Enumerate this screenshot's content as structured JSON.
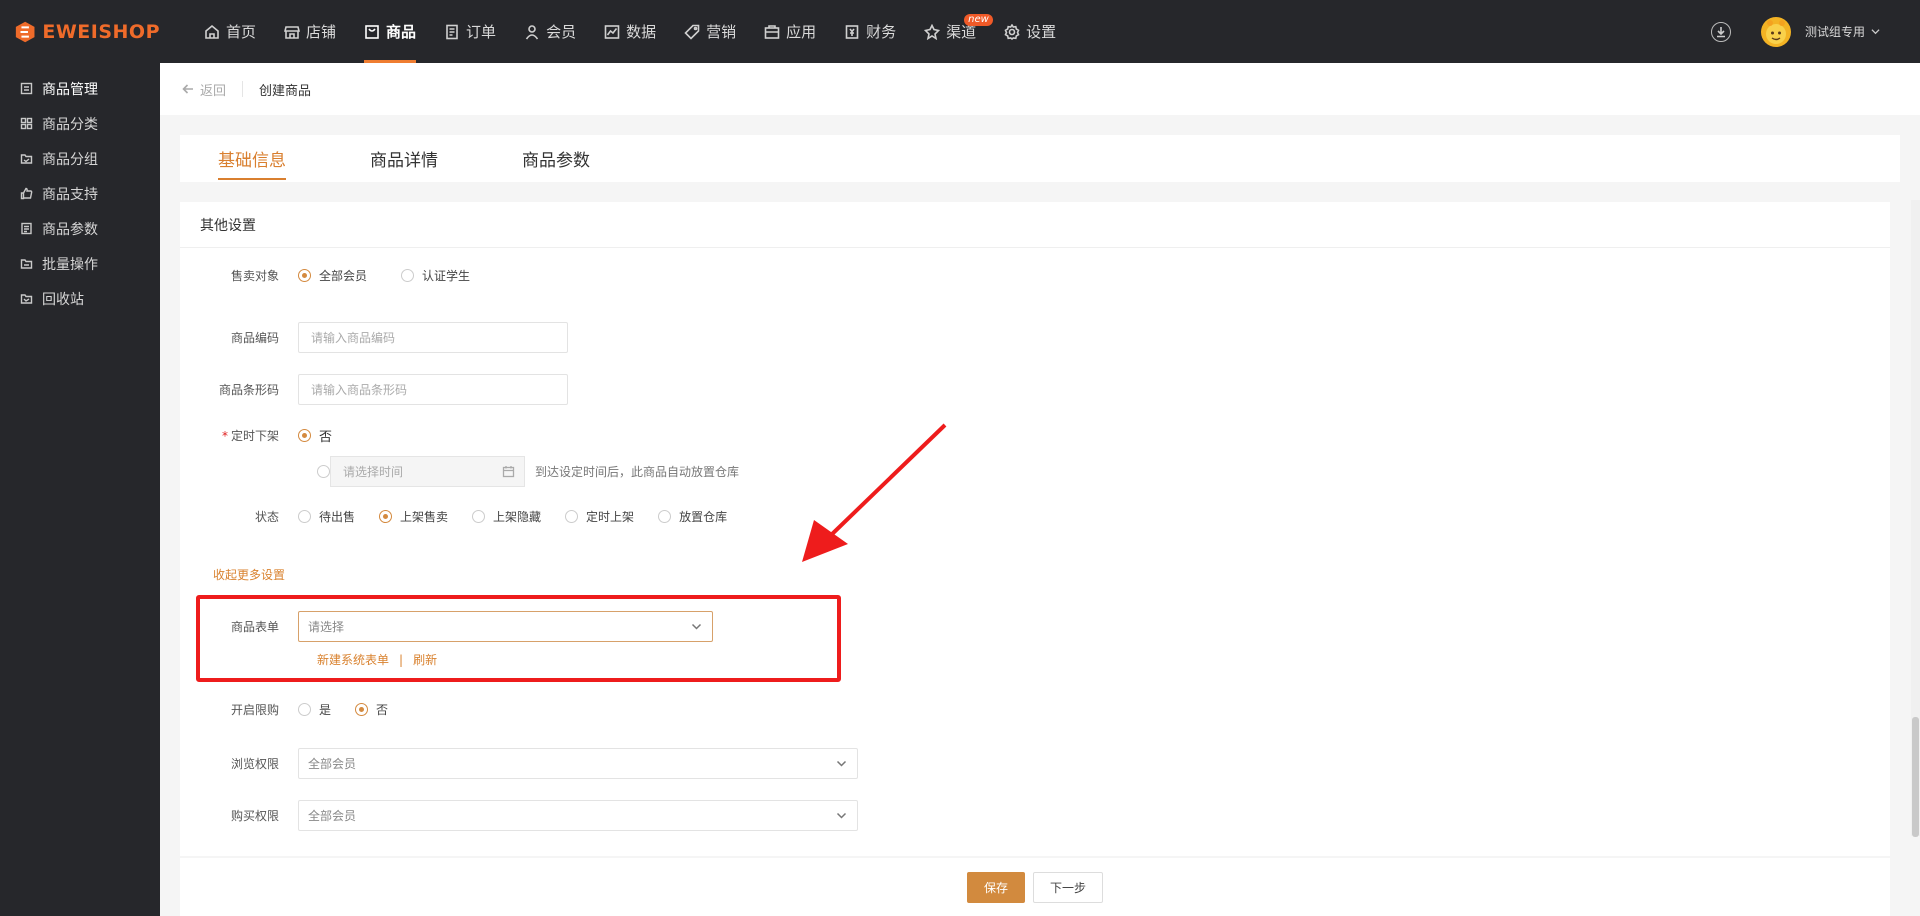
{
  "brand": {
    "name": "EWEISHOP",
    "accent": "#ef6b2a"
  },
  "nav": {
    "items": [
      {
        "label": "首页",
        "icon": "home-icon"
      },
      {
        "label": "店铺",
        "icon": "store-icon"
      },
      {
        "label": "商品",
        "icon": "goods-icon",
        "active": true
      },
      {
        "label": "订单",
        "icon": "order-icon"
      },
      {
        "label": "会员",
        "icon": "member-icon"
      },
      {
        "label": "数据",
        "icon": "data-icon"
      },
      {
        "label": "营销",
        "icon": "tag-icon"
      },
      {
        "label": "应用",
        "icon": "app-icon"
      },
      {
        "label": "财务",
        "icon": "finance-icon"
      },
      {
        "label": "渠道",
        "icon": "channel-icon",
        "badge": "new"
      },
      {
        "label": "设置",
        "icon": "gear-icon"
      }
    ],
    "user": "测试组专用"
  },
  "sidebar": {
    "items": [
      {
        "label": "商品管理",
        "active": true
      },
      {
        "label": "商品分类"
      },
      {
        "label": "商品分组"
      },
      {
        "label": "商品支持"
      },
      {
        "label": "商品参数"
      },
      {
        "label": "批量操作"
      },
      {
        "label": "回收站"
      }
    ]
  },
  "breadcrumb": {
    "back": "返回",
    "title": "创建商品"
  },
  "tabs": [
    "基础信息",
    "商品详情",
    "商品参数"
  ],
  "section": {
    "title": "其他设置"
  },
  "form": {
    "sale_target": {
      "label": "售卖对象",
      "options": [
        "全部会员",
        "认证学生"
      ],
      "selected": 0
    },
    "goods_code": {
      "label": "商品编码",
      "placeholder": "请输入商品编码"
    },
    "barcode": {
      "label": "商品条形码",
      "placeholder": "请输入商品条形码"
    },
    "timed_off": {
      "label": "定时下架",
      "required": "*",
      "option_no": "否",
      "date_placeholder": "请选择时间",
      "hint": "到达设定时间后，此商品自动放置仓库"
    },
    "status": {
      "label": "状态",
      "options": [
        "待出售",
        "上架售卖",
        "上架隐藏",
        "定时上架",
        "放置仓库"
      ],
      "selected": 1
    },
    "collapse_link": "收起更多设置",
    "goods_form": {
      "label": "商品表单",
      "placeholder": "请选择",
      "new_link": "新建系统表单",
      "separator": "|",
      "refresh_link": "刷新"
    },
    "limit": {
      "label": "开启限购",
      "options": [
        "是",
        "否"
      ],
      "selected": 1
    },
    "browse": {
      "label": "浏览权限",
      "value": "全部会员"
    },
    "buy": {
      "label": "购买权限",
      "value": "全部会员"
    }
  },
  "footer": {
    "save": "保存",
    "next": "下一步"
  }
}
